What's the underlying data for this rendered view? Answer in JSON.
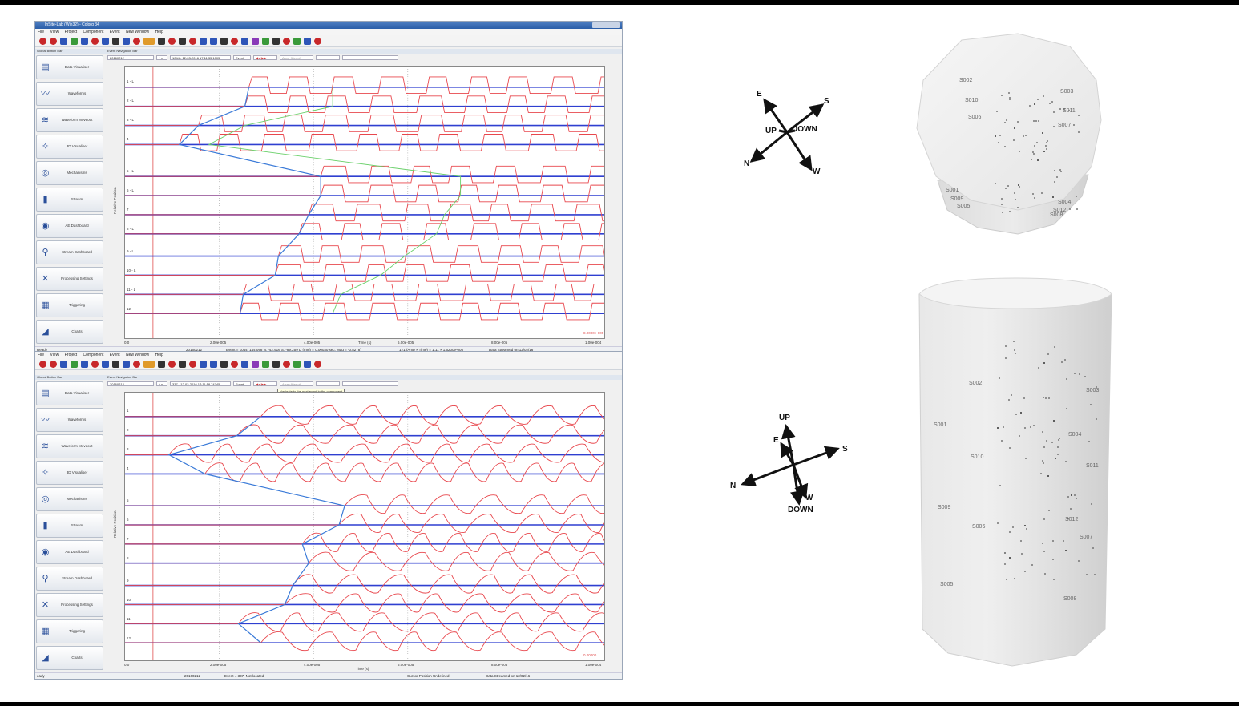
{
  "window1": {
    "title": "InSite-Lab (Win32) - Colorg 34",
    "menu": [
      "File",
      "View",
      "Project",
      "Component",
      "Event",
      "New Window",
      "Help"
    ],
    "left_panel_title": "Global Button Bar",
    "event_panel_title": "Event Navigation Bar",
    "nav": {
      "project": "20160212",
      "event_id": "1044 - 12-03-2016 17:11:35.1005",
      "event_label": "Event",
      "array_filter": "Array filter off"
    },
    "buttons": [
      "Data Visualiser",
      "Waveforms",
      "Waveform Moveout",
      "3D Visualiser",
      "Mechanisms",
      "Stream",
      "AE Dashboard",
      "Stream Dashboard",
      "Processing Settings",
      "Triggering",
      "Charts"
    ],
    "channels": [
      "1 - L",
      "2 - L",
      "3 - L",
      "4",
      "5 - L",
      "6 - L",
      "7",
      "8 - L",
      "9 - L",
      "10 - L",
      "11 - L",
      "12"
    ],
    "y_axis_label": "Relative Position",
    "x_axis_label": "Time (s)",
    "x_ticks": [
      "0.0",
      "2.00e-005",
      "4.00e-005",
      "6.00e-005",
      "8.00e-005",
      "1.00e-004"
    ],
    "corner_value": "8.0000e-005",
    "status": {
      "left": "Ready",
      "project": "20160212",
      "event": "Event = 1044, 144.098 N, -42.916 S, -89.259 D (mm) = 0.00030 sec, Mag = -0.8278)",
      "cursor": "1×1    (Amp × Time) = 1.11 × 1.6200e-005",
      "stream": "Data Streamed on 12/02/16"
    }
  },
  "window2": {
    "menu": [
      "File",
      "View",
      "Project",
      "Component",
      "Event",
      "New Window",
      "Help"
    ],
    "left_panel_title": "Global Button Bar",
    "event_panel_title": "Event Navigation Bar",
    "nav": {
      "project": "20160212",
      "event_id": "337 - 12-03-2016 17:11:18.74745",
      "event_label": "Event",
      "array_filter": "Array filter off"
    },
    "tooltip": "Navigate to the next event in the component",
    "buttons": [
      "Data Visualiser",
      "Waveforms",
      "Waveform Moveout",
      "3D Visualiser",
      "Mechanisms",
      "Stream",
      "AE Dashboard",
      "Stream Dashboard",
      "Processing Settings",
      "Triggering",
      "Charts"
    ],
    "channels": [
      "1",
      "2",
      "3",
      "4",
      "5",
      "6",
      "7",
      "8",
      "9",
      "10",
      "11",
      "12"
    ],
    "y_axis_label": "Relative Position",
    "x_axis_label": "Time (s)",
    "x_ticks": [
      "0.0",
      "2.00e-005",
      "4.00e-005",
      "6.00e-005",
      "8.00e-005",
      "1.00e-004"
    ],
    "corner_value": "0.00000",
    "status": {
      "left": "eady",
      "project": "20160212",
      "event": "Event = 337, Not located",
      "cursor": "Cursor Position Undefined",
      "stream": "Data Streamed on 12/02/16"
    }
  },
  "compass1": {
    "labels": [
      "E",
      "S",
      "UP",
      "DOWN",
      "N",
      "W"
    ]
  },
  "compass2": {
    "labels": [
      "UP",
      "E",
      "S",
      "N",
      "W",
      "DOWN"
    ]
  },
  "sensors_top": [
    "S002",
    "S003",
    "S010",
    "S011",
    "S006",
    "S007",
    "S001",
    "S009",
    "S005",
    "S004",
    "S012",
    "S008"
  ],
  "sensors_bottom": [
    "S002",
    "S003",
    "S001",
    "S004",
    "S010",
    "S011",
    "S009",
    "S006",
    "S012",
    "S007",
    "S005",
    "S008"
  ],
  "colors": {
    "trace_red": "#e8474d",
    "baseline_blue": "#2f3fd0",
    "pick_blue": "#3a7ad8",
    "pick_green": "#6ad06a",
    "accent": "#2b5ea8"
  }
}
